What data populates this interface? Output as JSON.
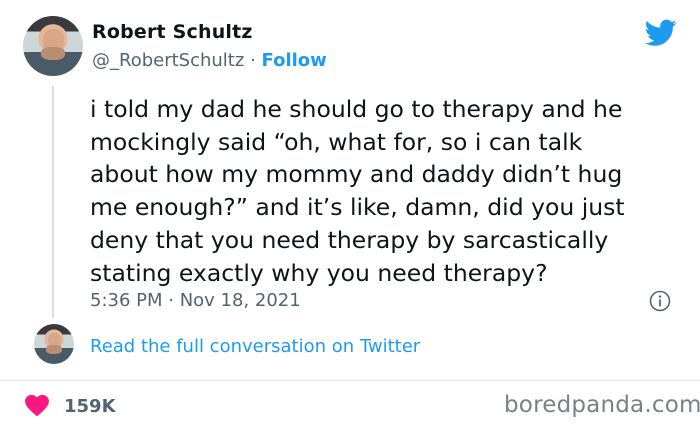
{
  "author": {
    "name": "Robert Schultz",
    "handle": "@_RobertSchultz",
    "separator": "·",
    "follow_label": "Follow"
  },
  "tweet": {
    "text": "i told my dad he should go to therapy and he\nmockingly said “oh, what for, so i can talk\nabout how my mommy and daddy didn’t hug\nme enough?” and it’s like, damn, did you just\ndeny that you need therapy by sarcastically\nstating exactly why you need therapy?",
    "timestamp": "5:36 PM · Nov 18, 2021"
  },
  "conversation": {
    "link_label": "Read the full conversation on Twitter"
  },
  "engagement": {
    "likes": "159K"
  },
  "watermark": "boredpanda.com",
  "icons": {
    "brand": "twitter-bird-icon",
    "info": "info-icon",
    "like": "heart-icon"
  },
  "colors": {
    "accent": "#1d9bf0",
    "like": "#f91880",
    "muted": "#536471"
  }
}
